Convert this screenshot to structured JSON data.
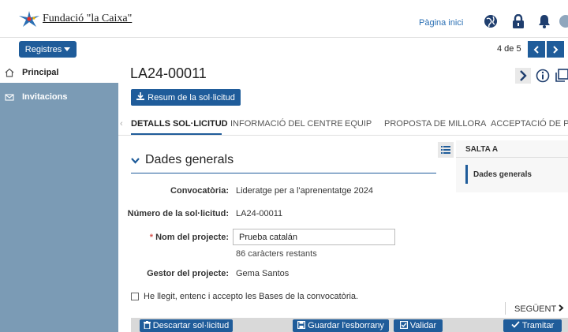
{
  "header": {
    "logo_text": "Fundació \"la Caixa\"",
    "home_link": "Pàgina inici",
    "icons": [
      "globe-icon",
      "lock-icon",
      "bell-icon",
      "avatar"
    ]
  },
  "toolbar": {
    "registres_label": "Registres",
    "pager_text": "4 de 5"
  },
  "sidebar": {
    "items": [
      {
        "label": "Principal",
        "icon": "home-icon"
      },
      {
        "label": "Invitacions",
        "icon": "mail-icon"
      }
    ]
  },
  "record": {
    "id": "LA24-00011",
    "summary_button": "Resum de la sol·licitud"
  },
  "tabs": [
    {
      "label": "DETALLS SOL·LICITUD",
      "active": true
    },
    {
      "label": "INFORMACIÓ DEL CENTRE",
      "active": false
    },
    {
      "label": "EQUIP",
      "active": false
    },
    {
      "label": "PROPOSTA DE MILLORA",
      "active": false
    },
    {
      "label": "ACCEPTACIÓ DE PAI",
      "active": false
    }
  ],
  "section": {
    "title": "Dades generals"
  },
  "jump_panel": {
    "heading": "SALTA A",
    "items": [
      "Dades generals"
    ]
  },
  "form": {
    "convocatoria_label": "Convocatòria:",
    "convocatoria_value": "Lideratge per a l'aprenentatge 2024",
    "numero_label": "Número de la sol·licitud:",
    "numero_value": "LA24-00011",
    "nom_required": "*",
    "nom_label": "Nom del projecte:",
    "nom_value": "Prueba catalán",
    "chars_left": "86 caràcters restants",
    "gestor_label": "Gestor del projecte:",
    "gestor_value": "Gema Santos",
    "accept_label": "He llegit, entenc i accepto les Bases de la convocatòria.",
    "accept_checked": false
  },
  "nav": {
    "next_label": "SEGÜENT"
  },
  "footer": {
    "descartar": "Descartar sol·licitud",
    "guardar": "Guardar l'esborrany",
    "validar": "Validar",
    "tramitar": "Tramitar"
  },
  "colors": {
    "primary": "#1f5c9a",
    "sidebar": "#7b9bb5",
    "required": "#d9534f"
  }
}
